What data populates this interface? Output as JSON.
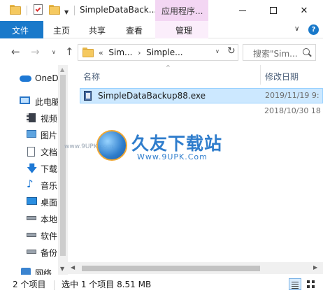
{
  "window": {
    "title": "SimpleDataBack...",
    "context_tab_header": "应用程序...",
    "minimize_glyph": "—",
    "maximize_glyph": "☐",
    "close_glyph": "✕"
  },
  "ribbon": {
    "file_tab": "文件",
    "tabs": [
      "主页",
      "共享",
      "查看",
      "管理"
    ],
    "collapse_glyph": "∨",
    "help_glyph": "?"
  },
  "navigation": {
    "back_glyph": "←",
    "forward_glyph": "→",
    "recent_glyph": "∨",
    "up_glyph": "↑",
    "address": {
      "prefix": "«",
      "segments": [
        "Sim...",
        "Simple..."
      ],
      "separator": "›",
      "dropdown_glyph": "∨",
      "refresh_glyph": "↻"
    },
    "search": {
      "placeholder": "搜索\"Sim..."
    }
  },
  "nav_pane": {
    "items": [
      {
        "label": "OneDr",
        "icon": "onedrive-icon"
      },
      {
        "label": "此电脑",
        "icon": "computer-icon"
      },
      {
        "label": "视频",
        "icon": "video-icon"
      },
      {
        "label": "图片",
        "icon": "pictures-icon"
      },
      {
        "label": "文档",
        "icon": "documents-icon"
      },
      {
        "label": "下载",
        "icon": "download-icon"
      },
      {
        "label": "音乐",
        "icon": "music-icon"
      },
      {
        "label": "桌面",
        "icon": "desktop-icon"
      },
      {
        "label": "本地",
        "icon": "local-drive-icon"
      },
      {
        "label": "软件",
        "icon": "drive-icon"
      },
      {
        "label": "备份",
        "icon": "drive-icon"
      },
      {
        "label": "网络",
        "icon": "network-icon"
      }
    ]
  },
  "file_list": {
    "columns": {
      "name": "名称",
      "modified": "修改日期"
    },
    "sort_glyph": "^",
    "rows": [
      {
        "name": "SimpleDataBackup88.exe",
        "date": "2019/11/19 9:",
        "selected": true
      },
      {
        "name": "",
        "date": "2018/10/30 18",
        "selected": false
      }
    ]
  },
  "watermark": {
    "text": "久友下载站",
    "url": "Www.9UPK.Com",
    "side": "www.9UPK.com"
  },
  "status": {
    "item_count": "2 个项目",
    "selection": "选中 1 个项目  8.51 MB"
  },
  "colors": {
    "accent": "#1979ca",
    "selection_bg": "#cce8ff",
    "context_tab": "#f3d6f3"
  }
}
